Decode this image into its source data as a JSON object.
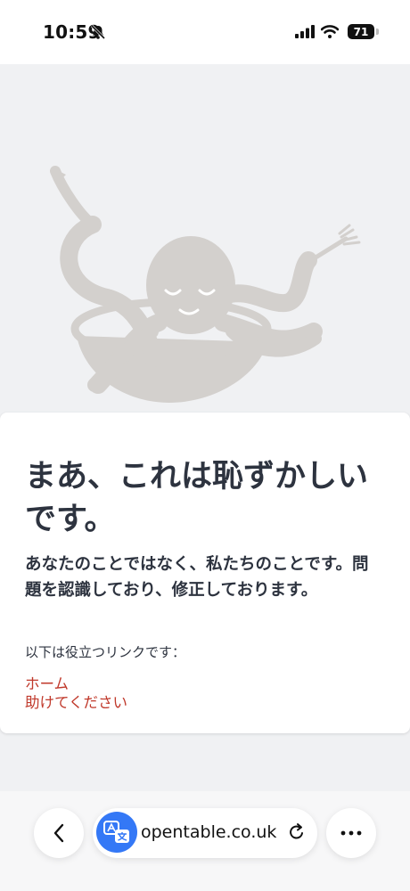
{
  "status_bar": {
    "time": "10:59",
    "battery": "71"
  },
  "error": {
    "headline": "まあ、これは恥ずかしいです。",
    "message": "あなたのことではなく、私たちのことです。問題を認識しており、修正しております。",
    "links_intro": "以下は役立つリンクです：",
    "links": [
      "ホーム",
      "助けてください"
    ]
  },
  "browser": {
    "url": "opentable.co.uk"
  },
  "colors": {
    "link": "#c0392b",
    "illustration": "#d3d0cd",
    "translate_badge": "#3478f6"
  }
}
